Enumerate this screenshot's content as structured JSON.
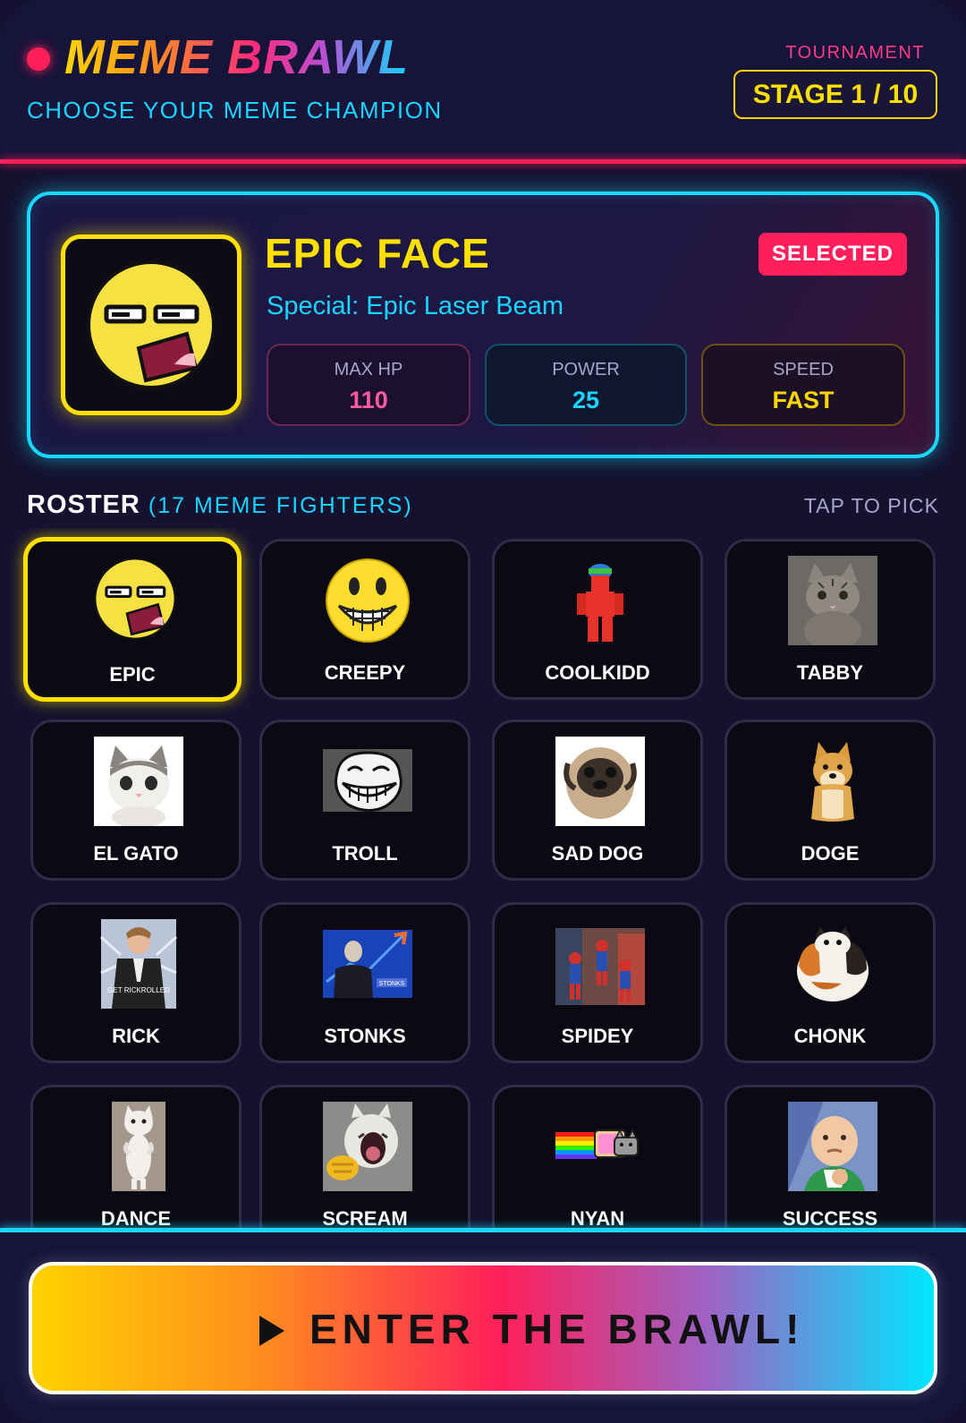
{
  "header": {
    "title_part1": "MEME ",
    "title_part2": "BRAWL",
    "subtitle": "CHOOSE YOUR MEME CHAMPION",
    "tournament_label": "TOURNAMENT",
    "stage_text": "STAGE 1 / 10"
  },
  "featured": {
    "name": "EPIC FACE",
    "special": "Special: Epic Laser Beam",
    "badge": "SELECTED",
    "stats": [
      {
        "label": "MAX HP",
        "value": "110"
      },
      {
        "label": "POWER",
        "value": "25"
      },
      {
        "label": "SPEED",
        "value": "FAST"
      }
    ]
  },
  "roster": {
    "title": "ROSTER",
    "count_text": "(17 MEME FIGHTERS)",
    "hint": "TAP TO PICK",
    "fighters": [
      {
        "label": "EPIC",
        "icon": "epic-face-icon"
      },
      {
        "label": "CREEPY",
        "icon": "creepy-smiley-icon"
      },
      {
        "label": "COOLKIDD",
        "icon": "coolkidd-icon"
      },
      {
        "label": "TABBY",
        "icon": "tabby-cat-icon"
      },
      {
        "label": "EL GATO",
        "icon": "el-gato-icon"
      },
      {
        "label": "TROLL",
        "icon": "troll-face-icon"
      },
      {
        "label": "SAD DOG",
        "icon": "sad-dog-icon"
      },
      {
        "label": "DOGE",
        "icon": "doge-icon"
      },
      {
        "label": "RICK",
        "icon": "rick-icon"
      },
      {
        "label": "STONKS",
        "icon": "stonks-icon"
      },
      {
        "label": "SPIDEY",
        "icon": "spidey-icon"
      },
      {
        "label": "CHONK",
        "icon": "chonk-icon"
      },
      {
        "label": "DANCE",
        "icon": "dance-cat-icon"
      },
      {
        "label": "SCREAM",
        "icon": "scream-cat-icon"
      },
      {
        "label": "NYAN",
        "icon": "nyan-cat-icon"
      },
      {
        "label": "SUCCESS",
        "icon": "success-kid-icon"
      }
    ],
    "rick_caption": "GET RICKROLLED",
    "stonks_caption": "STONKS"
  },
  "cta": {
    "label": "ENTER THE BRAWL!"
  },
  "colors": {
    "accent_pink": "#ff1f5a",
    "accent_cyan": "#17d8ff",
    "accent_yellow": "#ffe000"
  }
}
